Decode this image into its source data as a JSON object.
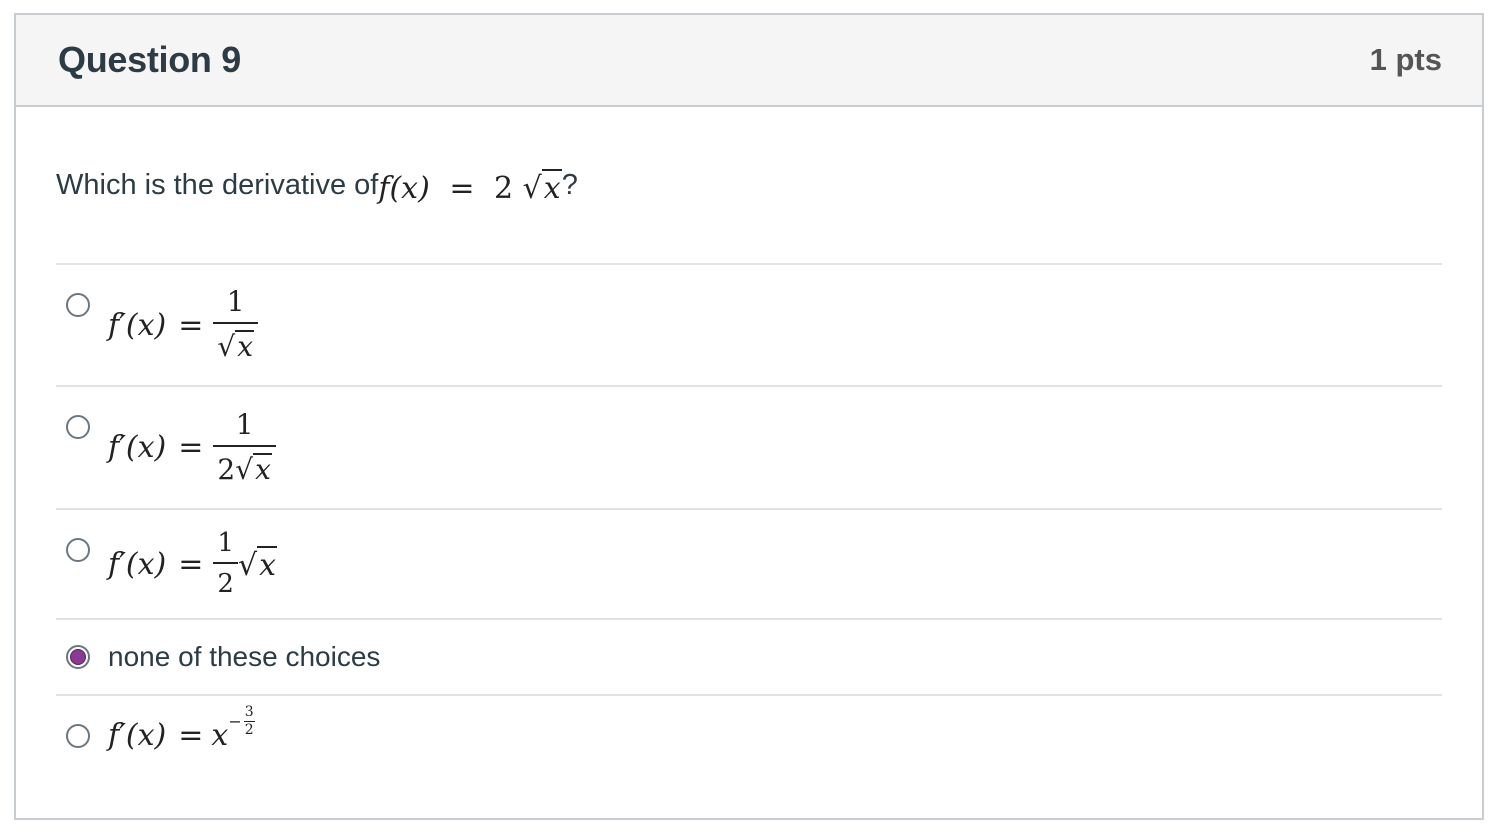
{
  "header": {
    "title": "Question 9",
    "points": "1 pts"
  },
  "question": {
    "prompt_text": "Which is the derivative of ",
    "function_lhs": "f(x)",
    "equals": "=",
    "coefficient": "2",
    "radicand": "x",
    "end_mark": "?"
  },
  "answers": [
    {
      "selected": false,
      "lhs": "f′(x)",
      "equals": "=",
      "numerator": "1",
      "denominator_radicand": "x"
    },
    {
      "selected": false,
      "lhs": "f′(x)",
      "equals": "=",
      "numerator": "1",
      "denominator_coefficient": "2",
      "denominator_radicand": "x"
    },
    {
      "selected": false,
      "lhs": "f′(x)",
      "equals": "=",
      "numerator": "1",
      "denominator": "2",
      "radicand": "x"
    },
    {
      "selected": true,
      "text": "none of these choices"
    },
    {
      "selected": false,
      "lhs": "f′(x)",
      "equals": "=",
      "base": "x",
      "exponent_sign": "−",
      "exponent_numerator": "3",
      "exponent_denominator": "2"
    }
  ],
  "colors": {
    "header_bg": "#f5f5f5",
    "border": "#c7cdd1",
    "selected_radio": "#8a3a93"
  }
}
